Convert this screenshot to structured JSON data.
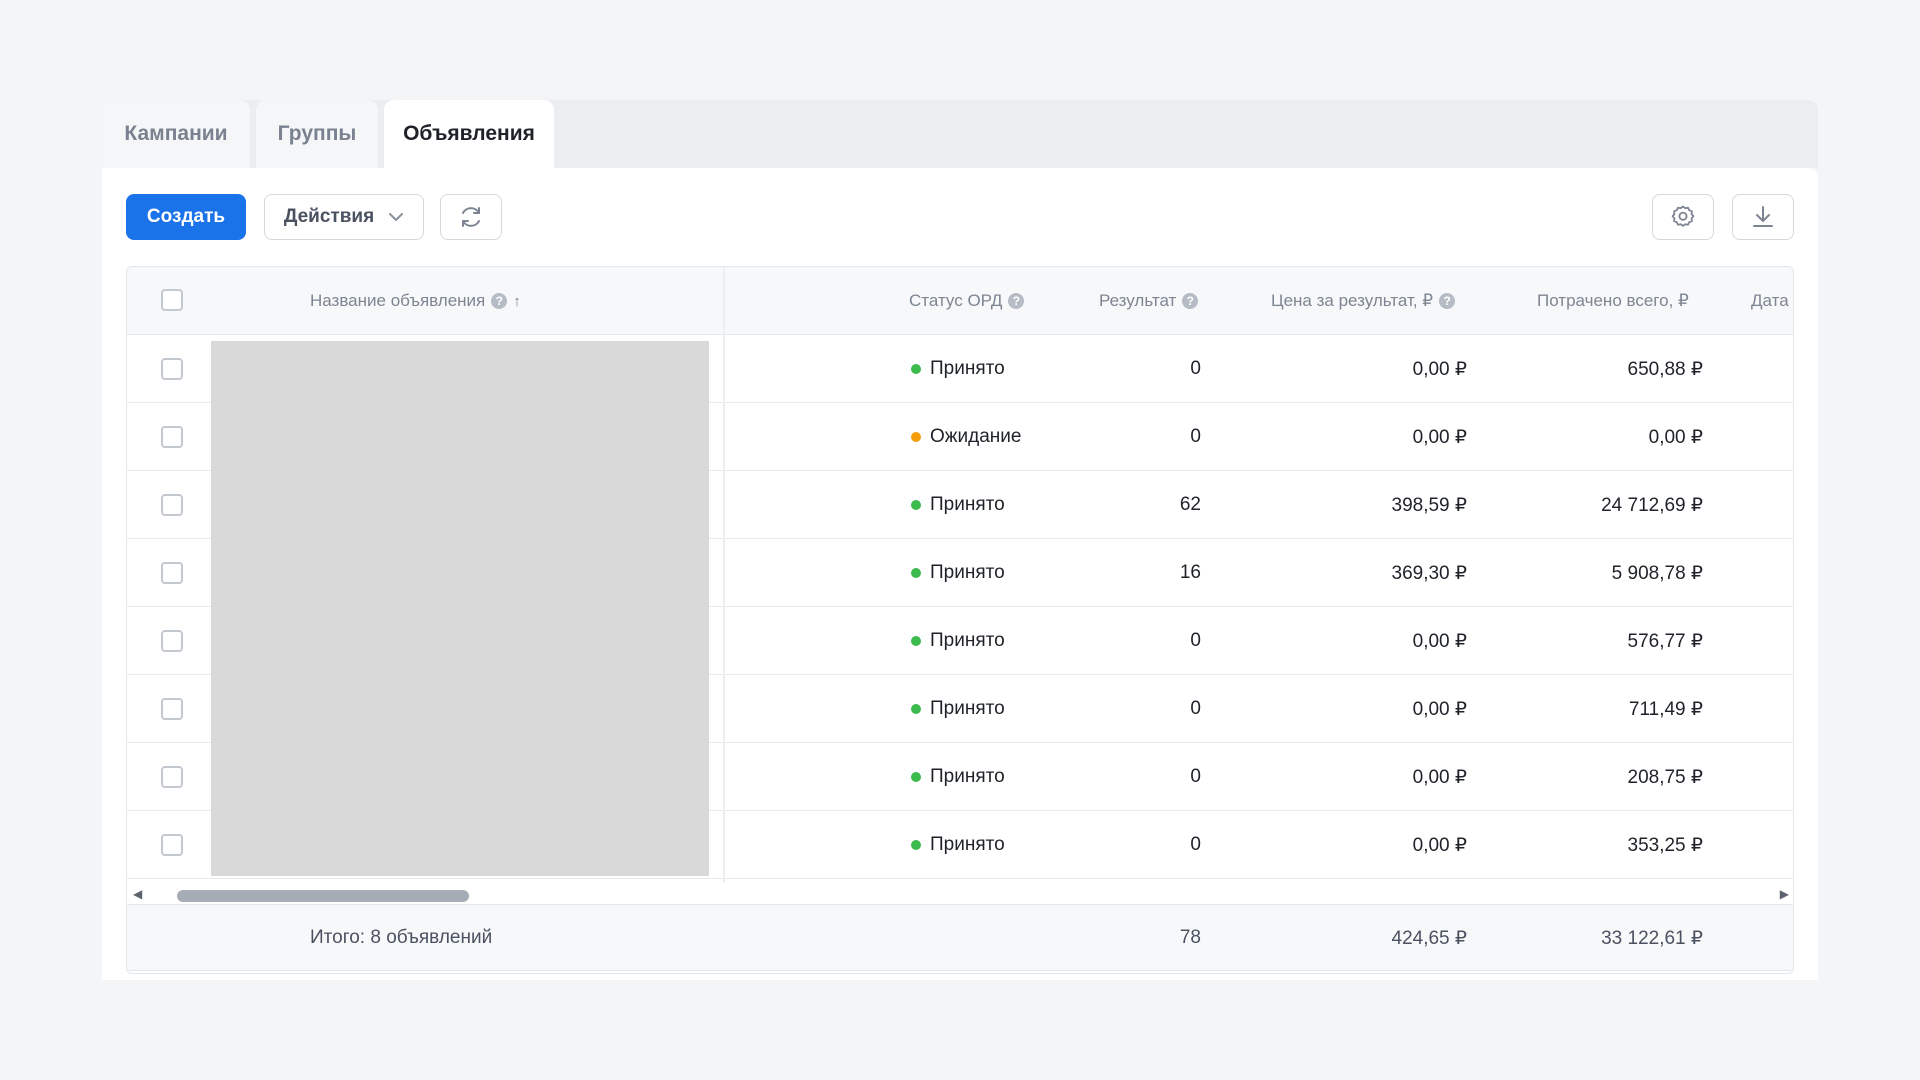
{
  "tabs": [
    {
      "label": "Кампании"
    },
    {
      "label": "Группы"
    },
    {
      "label": "Объявления",
      "active": true
    }
  ],
  "toolbar": {
    "create_label": "Создать",
    "actions_label": "Действия",
    "refresh_icon": "refresh-icon",
    "settings_icon": "gear-icon",
    "download_icon": "download-icon"
  },
  "table": {
    "columns": {
      "name": "Название объявления",
      "ord_status": "Статус ОРД",
      "result": "Результат",
      "cost_per_result": "Цена за результат, ₽",
      "spent_total": "Потрачено всего, ₽",
      "date": "Дата"
    },
    "rows": [
      {
        "status": "Принято",
        "status_color": "#3dba4e",
        "result": "0",
        "cost": "0,00 ₽",
        "spent": "650,88 ₽"
      },
      {
        "status": "Ожидание",
        "status_color": "#f59e0b",
        "result": "0",
        "cost": "0,00 ₽",
        "spent": "0,00 ₽"
      },
      {
        "status": "Принято",
        "status_color": "#3dba4e",
        "result": "62",
        "cost": "398,59 ₽",
        "spent": "24 712,69 ₽"
      },
      {
        "status": "Принято",
        "status_color": "#3dba4e",
        "result": "16",
        "cost": "369,30 ₽",
        "spent": "5 908,78 ₽"
      },
      {
        "status": "Принято",
        "status_color": "#3dba4e",
        "result": "0",
        "cost": "0,00 ₽",
        "spent": "576,77 ₽"
      },
      {
        "status": "Принято",
        "status_color": "#3dba4e",
        "result": "0",
        "cost": "0,00 ₽",
        "spent": "711,49 ₽"
      },
      {
        "status": "Принято",
        "status_color": "#3dba4e",
        "result": "0",
        "cost": "0,00 ₽",
        "spent": "208,75 ₽"
      },
      {
        "status": "Принято",
        "status_color": "#3dba4e",
        "result": "0",
        "cost": "0,00 ₽",
        "spent": "353,25 ₽"
      }
    ],
    "totals": {
      "label": "Итого: 8 объявлений",
      "result": "78",
      "cost": "424,65 ₽",
      "spent": "33 122,61 ₽"
    }
  },
  "colors": {
    "accent": "#1a73e8",
    "status_accepted": "#3dba4e",
    "status_pending": "#f59e0b"
  }
}
